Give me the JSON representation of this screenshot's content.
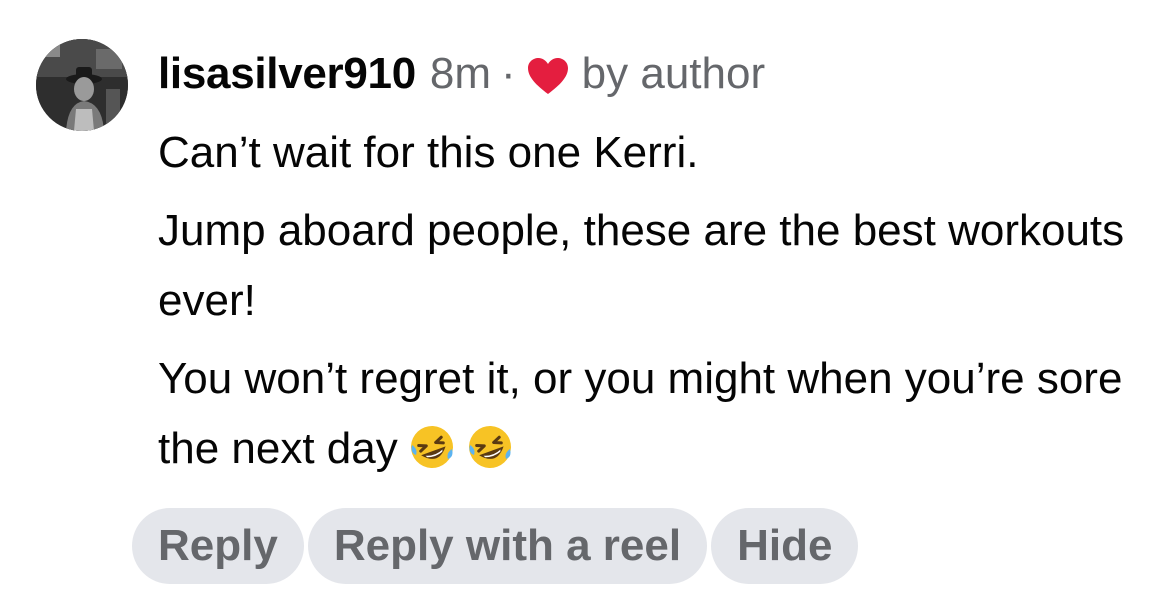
{
  "comment": {
    "username": "lisasilver910",
    "time": "8m",
    "separator": "·",
    "reaction_icon": "heart-icon",
    "reaction_color": "#e41e3f",
    "reaction_label": "by author",
    "paragraphs": [
      "Can’t wait for this one Kerri.",
      "Jump aboard people, these are the best workouts ever!",
      "You won’t regret it, or you might when you’re sore the next day"
    ],
    "emoji": "rolling-on-floor-laughing-icon"
  },
  "actions": {
    "reply_label": "Reply",
    "reply_reel_label": "Reply with a reel",
    "hide_label": "Hide"
  },
  "colors": {
    "secondary_text": "#65676b",
    "pill_background": "#e4e6eb"
  }
}
